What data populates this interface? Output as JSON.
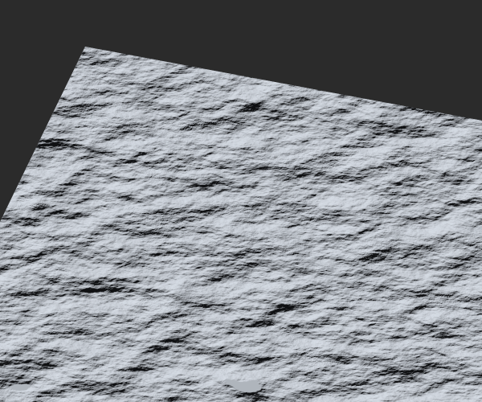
{
  "scene": {
    "subject": "terrain-heightmap",
    "colors": {
      "background": "#2b2b2b",
      "surface_light": "#c4cad3",
      "surface_shadow": "#2a3038"
    }
  }
}
